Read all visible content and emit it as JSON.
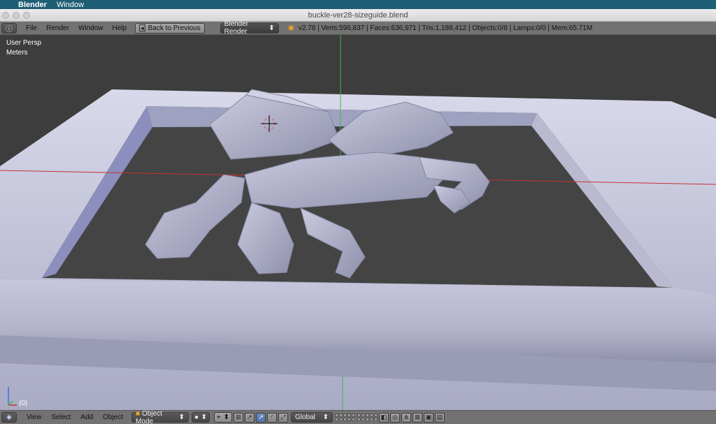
{
  "menubar": {
    "apple": "",
    "app_name": "Blender",
    "items": [
      "Window"
    ]
  },
  "window": {
    "title": "buckle-ver28-sizeguide.blend"
  },
  "info_header": {
    "menus": [
      "File",
      "Render",
      "Window",
      "Help"
    ],
    "back_button": "Back to Previous",
    "render_engine": "Blender Render",
    "stats": "v2.78 | Verts:596,837 | Faces:636,971 | Tris:1,188,412 | Objects:0/8 | Lamps:0/0 | Mem:65.71M"
  },
  "viewport": {
    "view_name": "User Persp",
    "units": "Meters",
    "frame": "(0)",
    "colors": {
      "background": "#3d3d3d",
      "model": "#b7b8cf",
      "x_axis": "#c83232",
      "y_axis": "#3dbb3d"
    }
  },
  "view_header": {
    "menus": [
      "View",
      "Select",
      "Add",
      "Object"
    ],
    "mode": "Object Mode",
    "orientation": "Global",
    "arrow": "⬍"
  }
}
